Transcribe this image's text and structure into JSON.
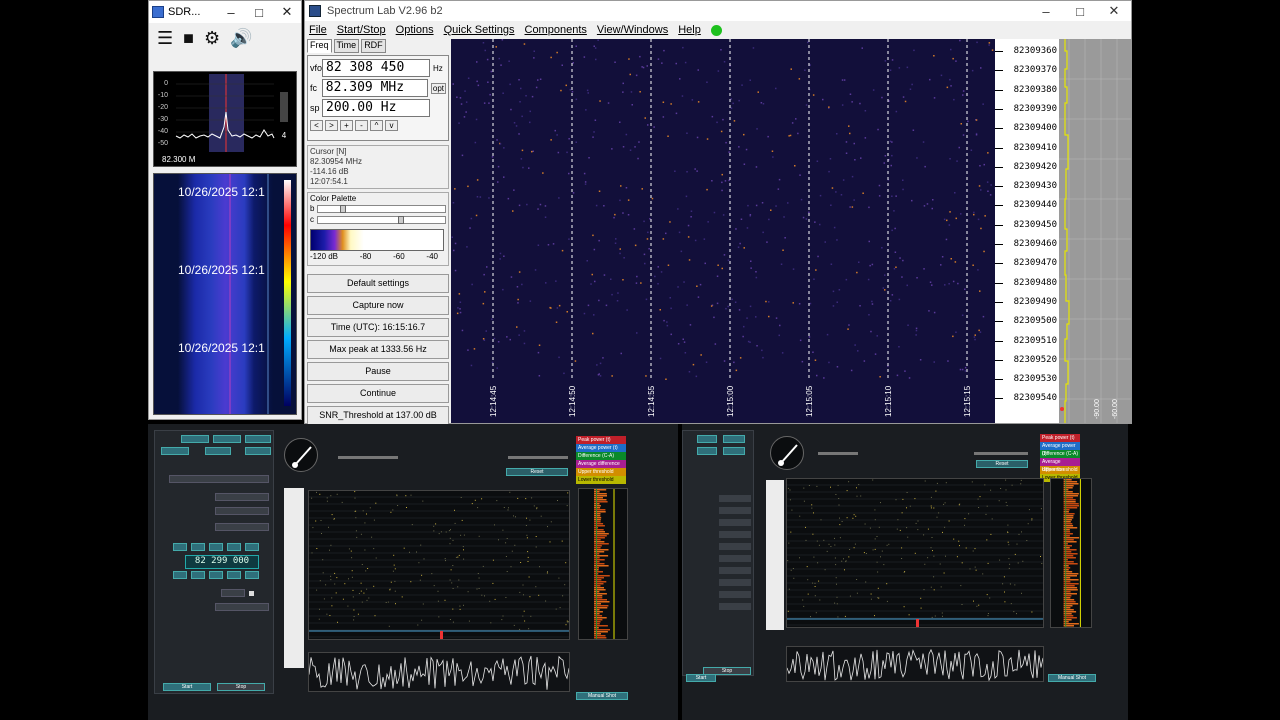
{
  "sdr": {
    "title": "SDR...",
    "spectrum_axis": [
      "0",
      "-10",
      "-20",
      "-30",
      "-40",
      "-50"
    ],
    "spectrum_freq": "82.300 M",
    "spectrum_side": "4",
    "waterfall_stamps": [
      "10/26/2025 12:1",
      "10/26/2025 12:1",
      "10/26/2025 12:1"
    ]
  },
  "spectrumlab": {
    "title": "Spectrum Lab V2.96 b2",
    "menu": [
      "File",
      "Start/Stop",
      "Options",
      "Quick Settings",
      "Components",
      "View/Windows",
      "Help"
    ],
    "tabs": [
      "Freq",
      "Time",
      "RDF"
    ],
    "vfo": {
      "label": "vfo",
      "value": "82 308 450",
      "unit": "Hz"
    },
    "fc": {
      "label": "fc",
      "value": "82.309 MHz",
      "unit": "opt"
    },
    "sp": {
      "label": "sp",
      "value": "200.00 Hz"
    },
    "steps": [
      "<",
      ">",
      "+",
      "-",
      "^",
      "v"
    ],
    "cursor": {
      "title": "Cursor [N]",
      "freq": "82.30954 MHz",
      "level": "-114.16 dB",
      "time": "12:07:54.1"
    },
    "palette": {
      "title": "Color Palette",
      "b": "b",
      "c": "c",
      "labels": [
        "-120 dB",
        "-80",
        "-60",
        "-40"
      ]
    },
    "buttons": {
      "default_settings": "Default settings",
      "capture_now": "Capture now",
      "time_utc": "Time (UTC):  16:15:16.7",
      "max_peak": "Max peak at 1333.56 Hz",
      "pause": "Pause",
      "continue": "Continue",
      "snr": "SNR_Threshold at 137.00 dB"
    },
    "time_labels": [
      "12:14:45",
      "12:14:50",
      "12:14:55",
      "12:15:00",
      "12:15:05",
      "12:15:10",
      "12:15:15"
    ],
    "freq_labels": [
      "82309360",
      "82309370",
      "82309380",
      "82309390",
      "82309400",
      "82309410",
      "82309420",
      "82309430",
      "82309440",
      "82309450",
      "82309460",
      "82309470",
      "82309480",
      "82309490",
      "82309500",
      "82309510",
      "82309520",
      "82309530",
      "82309540"
    ],
    "power_labels": [
      "-90.00",
      "-60.00"
    ]
  },
  "bottom_left": {
    "freq_display": "82 299 000",
    "legend": [
      "Peak power (t)",
      "Average power (t)",
      "Difference (C-A)",
      "Average difference",
      "Upper threshold",
      "Lower threshold"
    ],
    "buttons": [
      "Start",
      "Stop",
      "Reset",
      "Manual Shot"
    ]
  },
  "bottom_right": {
    "legend": [
      "Peak power (t)",
      "Average power (t)",
      "Difference (C-A)",
      "Average difference",
      "Upper threshold",
      "Lower threshold"
    ],
    "buttons": [
      "Start",
      "Stop",
      "Reset",
      "Manual Shot"
    ]
  },
  "colors": {
    "green_status": "#1ec11e",
    "teal": "#2f6f7a",
    "waterfall_bg": "#120f3a"
  }
}
